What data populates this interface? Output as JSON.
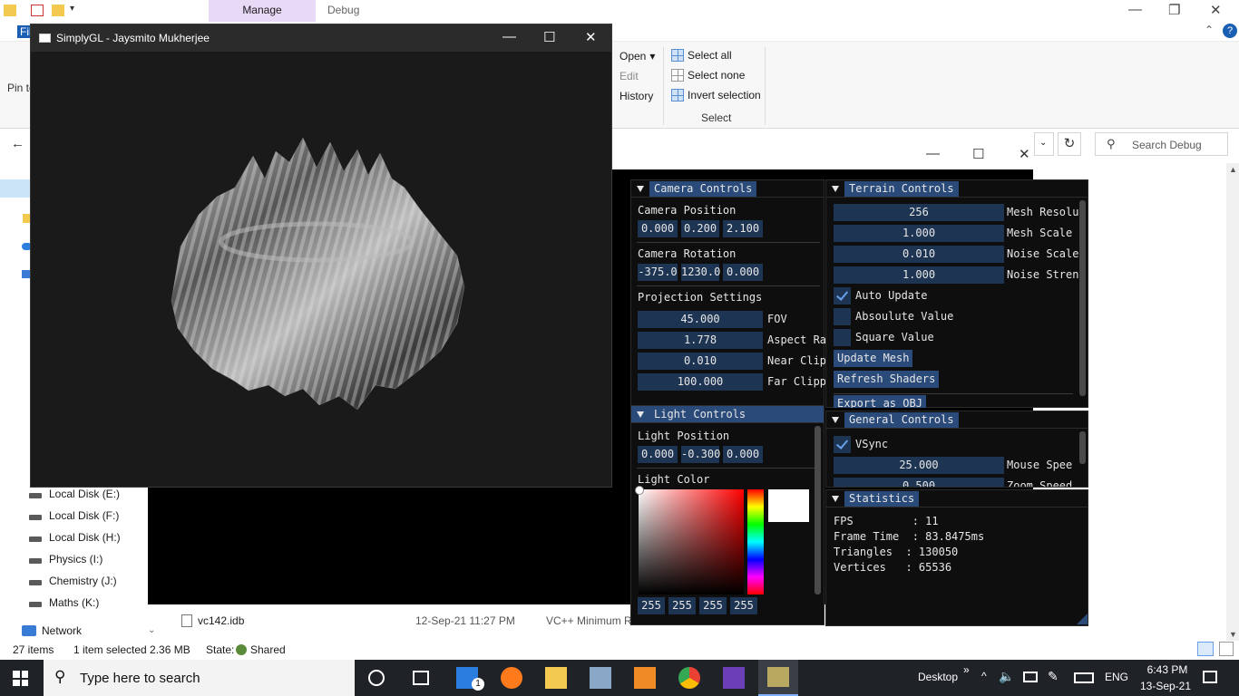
{
  "explorer": {
    "ribbon_tab_manage": "Manage",
    "ribbon_tab_debug": "Debug",
    "file_tab_label": "File",
    "pin_label": "Pin to",
    "open_label": "Open",
    "edit_label": "Edit",
    "history_label": "History",
    "select_all": "Select all",
    "select_none": "Select none",
    "invert_selection": "Invert selection",
    "select_group": "Select",
    "search_placeholder": "Search Debug",
    "nav": [
      {
        "label": "Local Disk (E:)"
      },
      {
        "label": "Local Disk (F:)"
      },
      {
        "label": "Local Disk (H:)"
      },
      {
        "label": "Physics (I:)"
      },
      {
        "label": "Chemistry (J:)"
      },
      {
        "label": "Maths (K:)"
      }
    ],
    "network_label": "Network",
    "files": [
      {
        "name": "vc142.idb",
        "date": "12-Sep-21 11:27 PM",
        "type": "VC++ Minimum R"
      }
    ],
    "status": {
      "items": "27 items",
      "selected": "1 item selected  2.36 MB",
      "state_label": "State:",
      "state_value": "Shared"
    }
  },
  "glwindow": {
    "title": "SimplyGL - Jaysmito Mukherjee"
  },
  "imgui": {
    "camera": {
      "header": "Camera Controls",
      "position_label": "Camera Position",
      "position": [
        "0.000",
        "0.200",
        "2.100"
      ],
      "rotation_label": "Camera Rotation",
      "rotation": [
        "-375.0",
        "1230.0",
        "0.000"
      ],
      "projection_label": "Projection Settings",
      "fov_value": "45.000",
      "fov_label": "FOV",
      "aspect_value": "1.778",
      "aspect_label": "Aspect Ra",
      "near_value": "0.010",
      "near_label": "Near Clip",
      "far_value": "100.000",
      "far_label": "Far Clipp"
    },
    "terrain": {
      "header": "Terrain Controls",
      "mesh_res_value": "256",
      "mesh_res_label": "Mesh Resolu",
      "mesh_scale_value": "1.000",
      "mesh_scale_label": "Mesh Scale",
      "noise_scale_value": "0.010",
      "noise_scale_label": "Noise Scale",
      "noise_str_value": "1.000",
      "noise_str_label": "Noise Stren",
      "auto_update": "Auto Update",
      "absolute_value": "Absoulute Value",
      "square_value": "Square Value",
      "update_mesh": "Update Mesh",
      "refresh_shaders": "Refresh Shaders",
      "export_obj": "Export as OBJ"
    },
    "light": {
      "header": "Light Controls",
      "position_label": "Light Position",
      "position": [
        "0.000",
        "-0.300",
        "0.000"
      ],
      "color_label": "Light Color",
      "rgba": [
        "255",
        "255",
        "255",
        "255"
      ]
    },
    "general": {
      "header": "General Controls",
      "vsync": "VSync",
      "mouse_speed_value": "25.000",
      "mouse_speed_label": "Mouse Spee",
      "zoom_speed_value": "0.500",
      "zoom_speed_label": "Zoom Speed"
    },
    "stats": {
      "header": "Statistics",
      "lines": [
        "FPS         : 11",
        "Frame Time  : 83.8475ms",
        "Triangles  : 130050",
        "Vertices   : 65536"
      ]
    }
  },
  "taskbar": {
    "search_placeholder": "Type here to search",
    "desktop_label": "Desktop",
    "lang": "ENG",
    "time": "6:43 PM",
    "date": "13-Sep-21",
    "mail_badge": "1"
  }
}
